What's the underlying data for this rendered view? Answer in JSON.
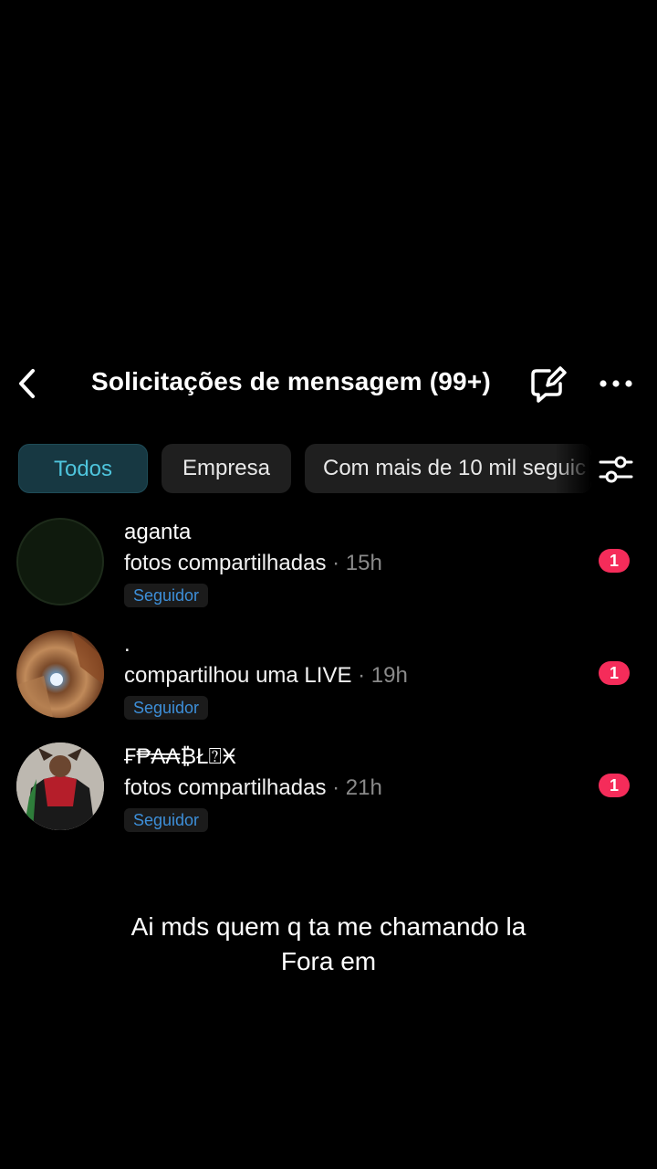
{
  "header": {
    "title": "Solicitações de mensagem (99+)",
    "back_icon": "chevron-left-icon",
    "edit_icon": "chat-edit-icon",
    "more_icon": "more-horizontal-icon"
  },
  "tabs": [
    {
      "label": "Todos",
      "active": true
    },
    {
      "label": "Empresa",
      "active": false
    },
    {
      "label": "Com mais de 10 mil seguic",
      "active": false
    }
  ],
  "filter_icon": "sliders-icon",
  "requests": [
    {
      "name": "aganta",
      "message": "fotos compartilhadas",
      "time": " · 15h",
      "badge": "Seguidor",
      "unread": "1"
    },
    {
      "name": ".",
      "message": "compartilhou uma LIVE",
      "time": " · 19h",
      "badge": "Seguidor",
      "unread": "1"
    },
    {
      "name": "₣₱₳₳₿Ł⍰Ӿ",
      "message": "fotos compartilhadas",
      "time": " · 21h",
      "badge": "Seguidor",
      "unread": "1"
    }
  ],
  "caption": {
    "line1": "Ai mds quem q ta me chamando la",
    "line2": "Fora em"
  },
  "colors": {
    "background": "#000000",
    "active_tab_bg": "#173842",
    "active_tab_text": "#4ec4dc",
    "badge_text": "#3d8fd9",
    "unread_bg": "#f52c5a"
  }
}
